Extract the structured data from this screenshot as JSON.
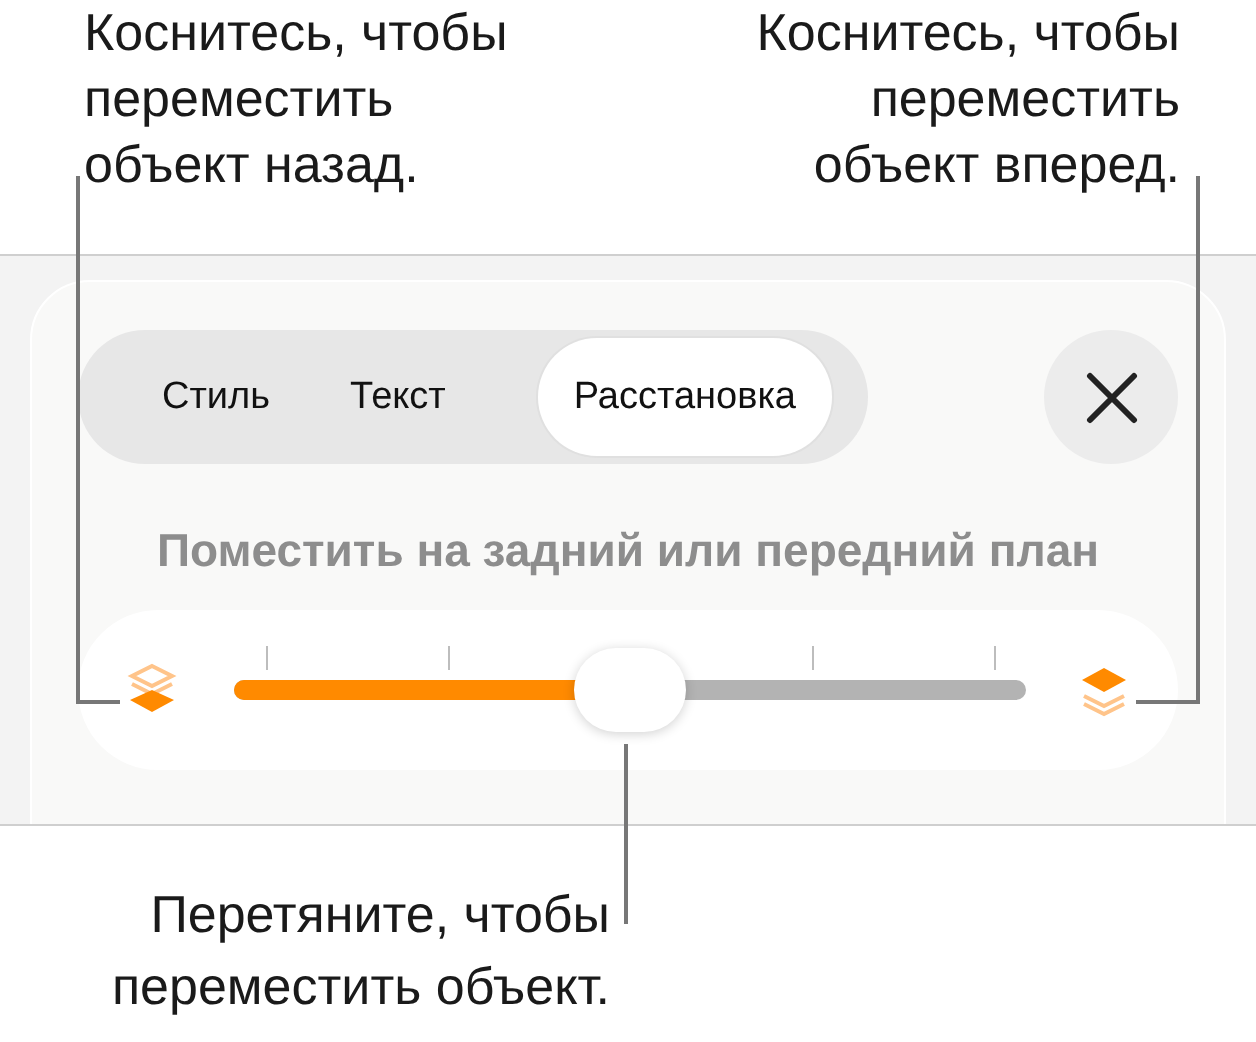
{
  "left_callout": {
    "text": "Коснитесь, чтобы\nпереместить\nобъект назад."
  },
  "right_callout": {
    "text": "Коснитесь, чтобы\nпереместить\nобъект вперед."
  },
  "tabs": [
    {
      "label": "Стиль",
      "selected": false
    },
    {
      "label": "Текст",
      "selected": false
    },
    {
      "label": "Расстановка",
      "selected": true
    }
  ],
  "subtitle": "Поместить на задний или передний план",
  "slider": {
    "level": 0.5
  },
  "bottom_callout": {
    "text": "Перетяните, чтобы\nпереместить объект."
  }
}
